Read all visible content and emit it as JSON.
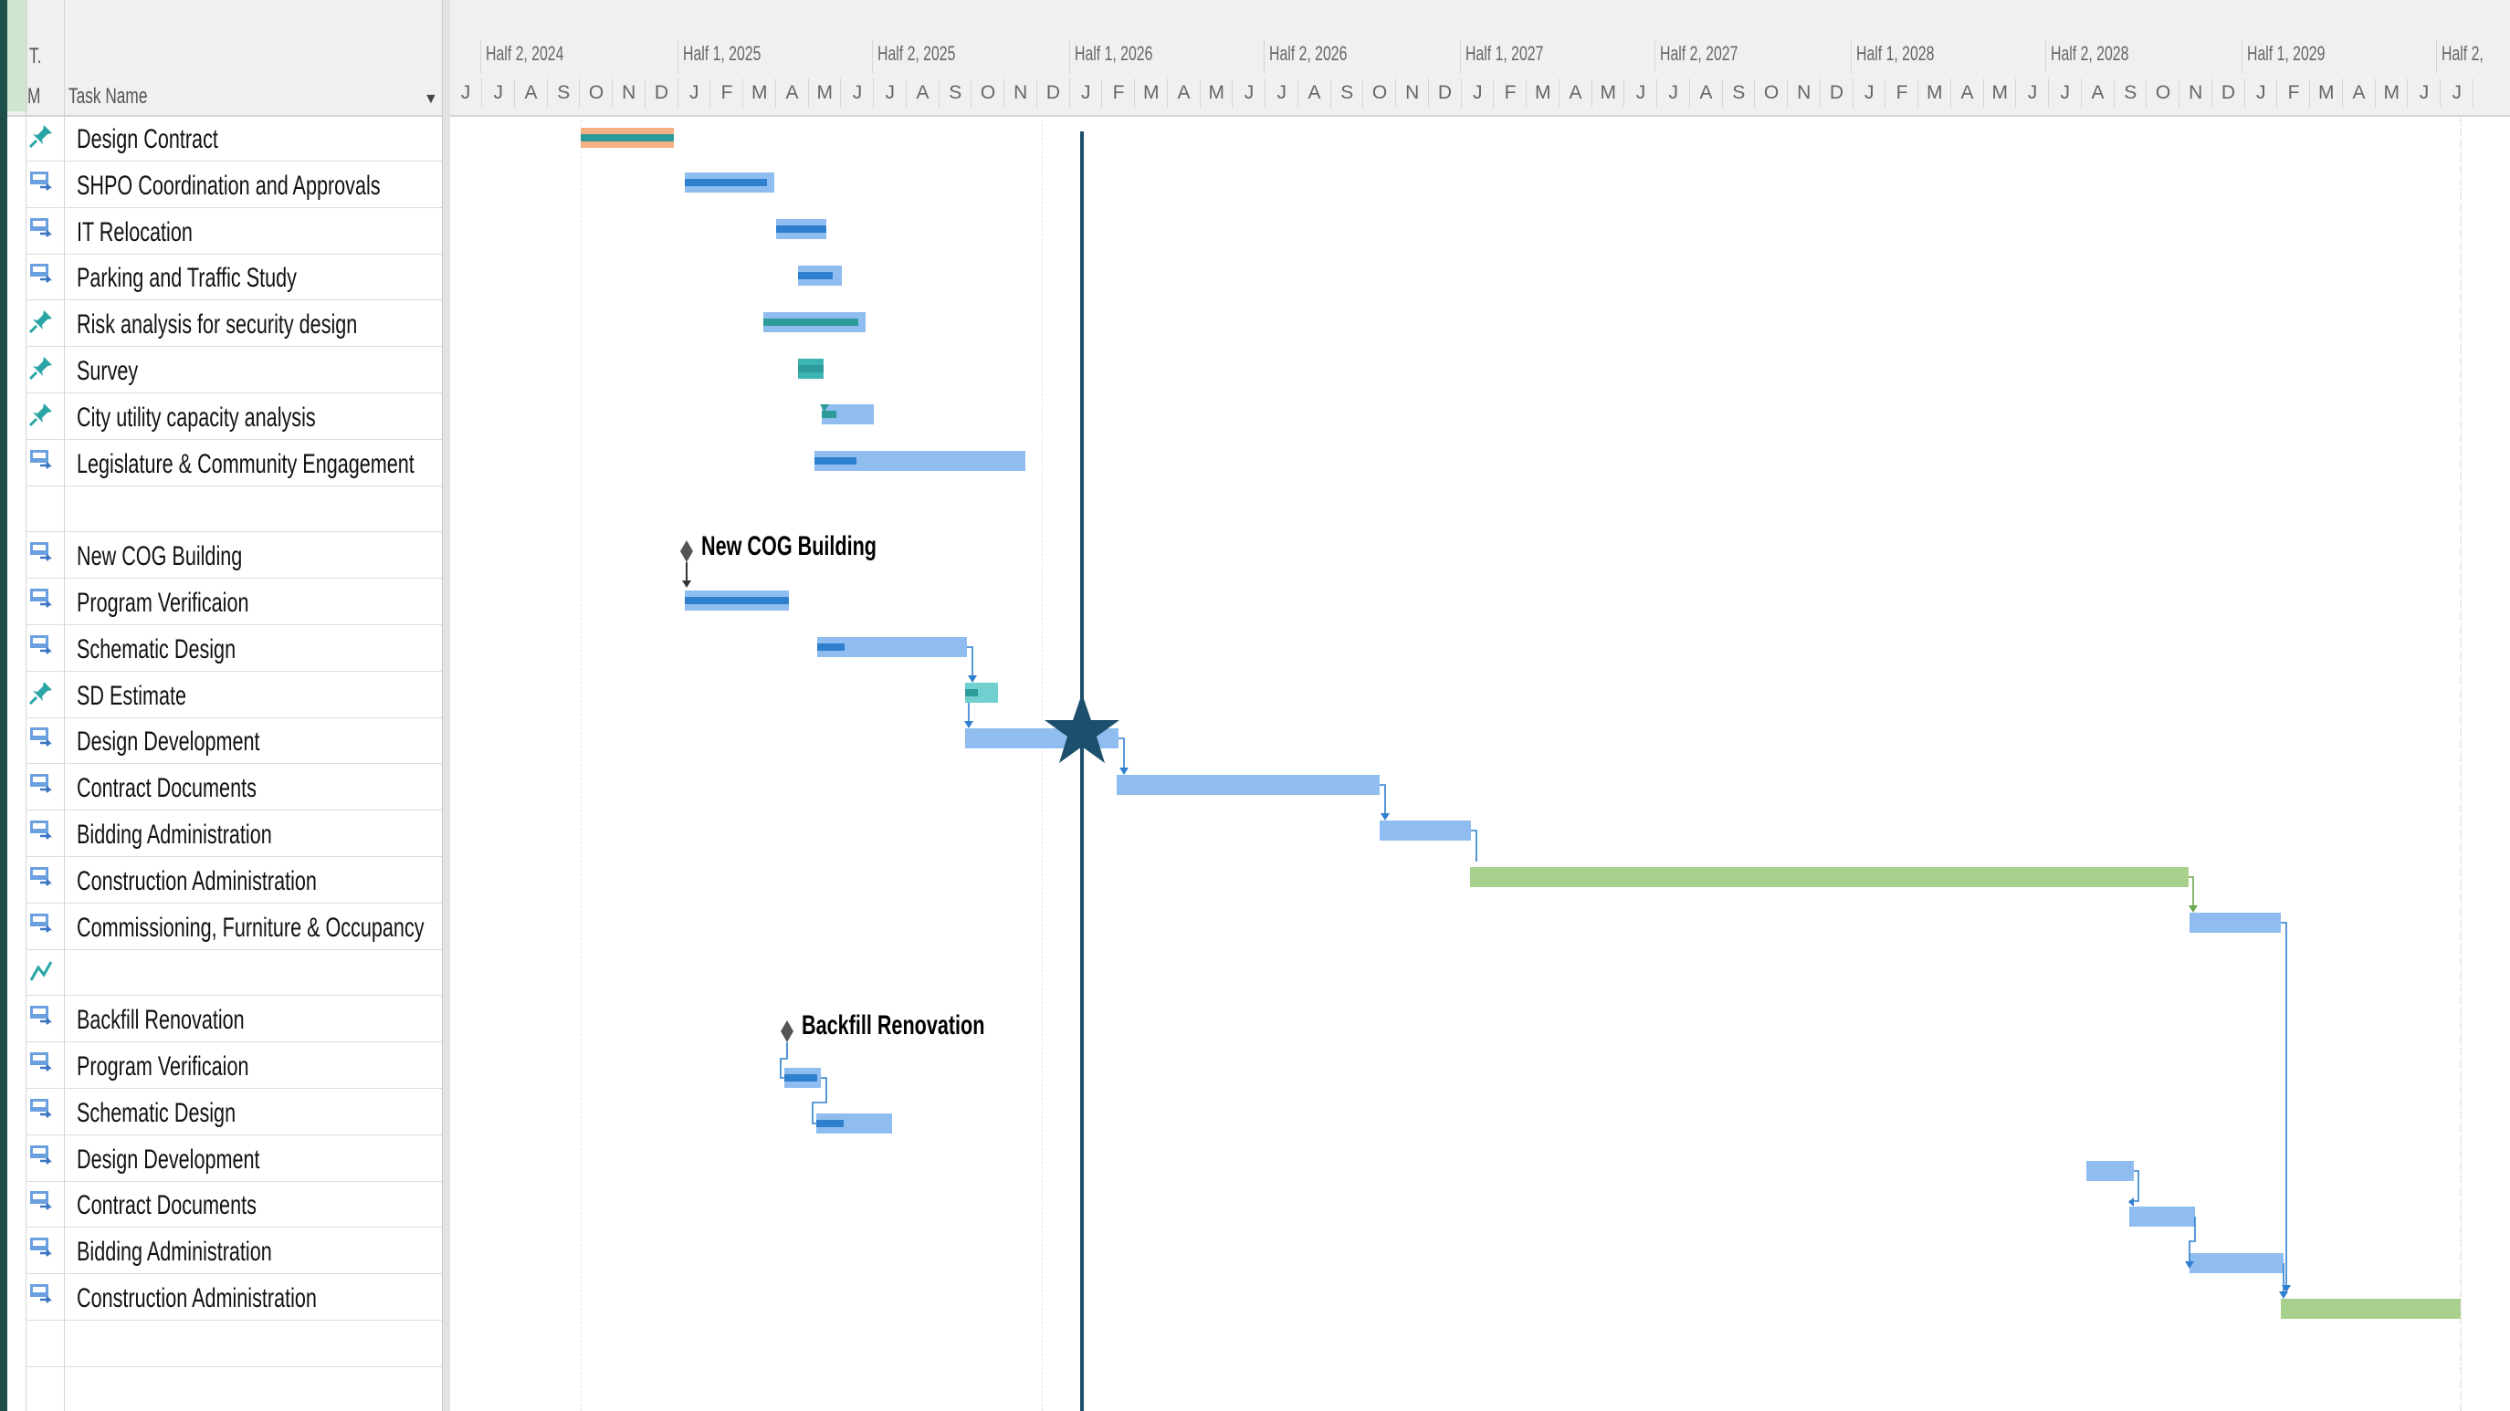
{
  "header": {
    "type_col": "T.",
    "mode_col": "M",
    "task_col": "Task Name"
  },
  "timeline": {
    "halves": [
      "Half 2, 2024",
      "Half 1, 2025",
      "Half 2, 2025",
      "Half 1, 2026",
      "Half 2, 2026",
      "Half 1, 2027",
      "Half 2, 2027",
      "Half 1, 2028",
      "Half 2, 2028",
      "Half 1, 2029",
      "Half 2,"
    ],
    "months": [
      "J",
      "J",
      "A",
      "S",
      "O",
      "N",
      "D",
      "J",
      "F",
      "M",
      "A",
      "M",
      "J",
      "J",
      "A",
      "S",
      "O",
      "N",
      "D",
      "J",
      "F",
      "M",
      "A",
      "M",
      "J",
      "J",
      "A",
      "S",
      "O",
      "N",
      "D",
      "J",
      "F",
      "M",
      "A",
      "M",
      "J",
      "J",
      "A",
      "S",
      "O",
      "N",
      "D",
      "J",
      "F",
      "M",
      "A",
      "M",
      "J",
      "J",
      "A",
      "S",
      "O",
      "N",
      "D",
      "J",
      "F",
      "M",
      "A",
      "M",
      "J",
      "J"
    ]
  },
  "tasks": [
    {
      "name": "Design Contract",
      "icon": "pin-icon"
    },
    {
      "name": "SHPO Coordination and Approvals",
      "icon": "auto-task-icon"
    },
    {
      "name": "IT Relocation",
      "icon": "auto-task-icon"
    },
    {
      "name": "Parking and Traffic Study",
      "icon": "auto-task-icon"
    },
    {
      "name": "Risk analysis for security design",
      "icon": "pin-icon"
    },
    {
      "name": "Survey",
      "icon": "pin-icon"
    },
    {
      "name": "City utility capacity analysis",
      "icon": "pin-icon"
    },
    {
      "name": "Legislature & Community Engagement",
      "icon": "auto-task-icon"
    },
    {
      "name": "",
      "icon": ""
    },
    {
      "name": "New COG Building",
      "icon": "auto-task-icon"
    },
    {
      "name": "Program Verificaion",
      "icon": "auto-task-icon"
    },
    {
      "name": "Schematic Design",
      "icon": "auto-task-icon"
    },
    {
      "name": "SD Estimate",
      "icon": "pin-icon"
    },
    {
      "name": "Design Development",
      "icon": "auto-task-icon"
    },
    {
      "name": "Contract Documents",
      "icon": "auto-task-icon"
    },
    {
      "name": "Bidding Administration",
      "icon": "auto-task-icon"
    },
    {
      "name": "Construction Administration",
      "icon": "auto-task-icon"
    },
    {
      "name": "Commissioning, Furniture & Occupancy",
      "icon": "auto-task-icon"
    },
    {
      "name": "",
      "icon": "manual-task-icon"
    },
    {
      "name": "Backfill Renovation",
      "icon": "auto-task-icon"
    },
    {
      "name": "Program Verificaion",
      "icon": "auto-task-icon"
    },
    {
      "name": "Schematic Design",
      "icon": "auto-task-icon"
    },
    {
      "name": "Design Development",
      "icon": "auto-task-icon"
    },
    {
      "name": "Contract Documents",
      "icon": "auto-task-icon"
    },
    {
      "name": "Bidding Administration",
      "icon": "auto-task-icon"
    },
    {
      "name": "Construction Administration",
      "icon": "auto-task-icon"
    },
    {
      "name": "",
      "icon": ""
    }
  ],
  "gantt_labels": {
    "cog_summary": "New COG Building",
    "backfill_summary": "Backfill Renovation"
  },
  "colors": {
    "auto_bar": "#90bdf0",
    "progress": "#2f7fcf",
    "manual_bar": "#3cb4b4",
    "construction_bar": "#a8d08d",
    "today_line": "#1b4f6b",
    "star": "#1b4f6b"
  }
}
